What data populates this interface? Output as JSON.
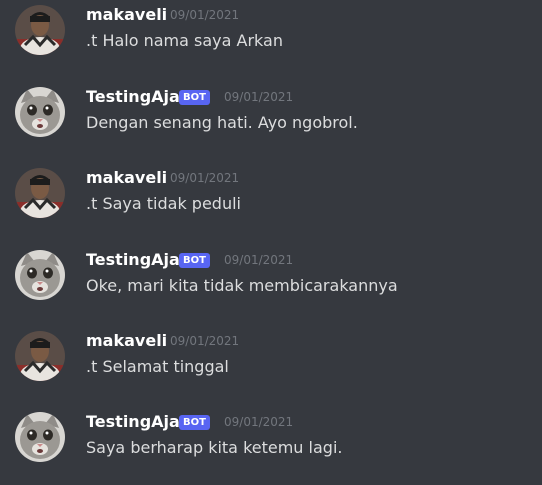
{
  "messages": [
    {
      "author": "makaveli",
      "bot": false,
      "timestamp": "09/01/2021",
      "text": ".t Halo nama saya Arkan",
      "avatar": "user-avatar"
    },
    {
      "author": "TestingAja",
      "bot": true,
      "bot_label": "BOT",
      "timestamp": "09/01/2021",
      "text": "Dengan senang hati. Ayo ngobrol.",
      "avatar": "cat-avatar"
    },
    {
      "author": "makaveli",
      "bot": false,
      "timestamp": "09/01/2021",
      "text": ".t Saya tidak peduli",
      "avatar": "user-avatar"
    },
    {
      "author": "TestingAja",
      "bot": true,
      "bot_label": "BOT",
      "timestamp": "09/01/2021",
      "text": "Oke, mari kita tidak membicarakannya",
      "avatar": "cat-avatar"
    },
    {
      "author": "makaveli",
      "bot": false,
      "timestamp": "09/01/2021",
      "text": ".t Selamat tinggal",
      "avatar": "user-avatar"
    },
    {
      "author": "TestingAja",
      "bot": true,
      "bot_label": "BOT",
      "timestamp": "09/01/2021",
      "text": "Saya berharap kita ketemu lagi.",
      "avatar": "cat-avatar"
    }
  ],
  "colors": {
    "background": "#36393f",
    "username": "#ffffff",
    "message_text": "#dcddde",
    "timestamp": "#72767d",
    "bot_tag": "#5865f2"
  }
}
